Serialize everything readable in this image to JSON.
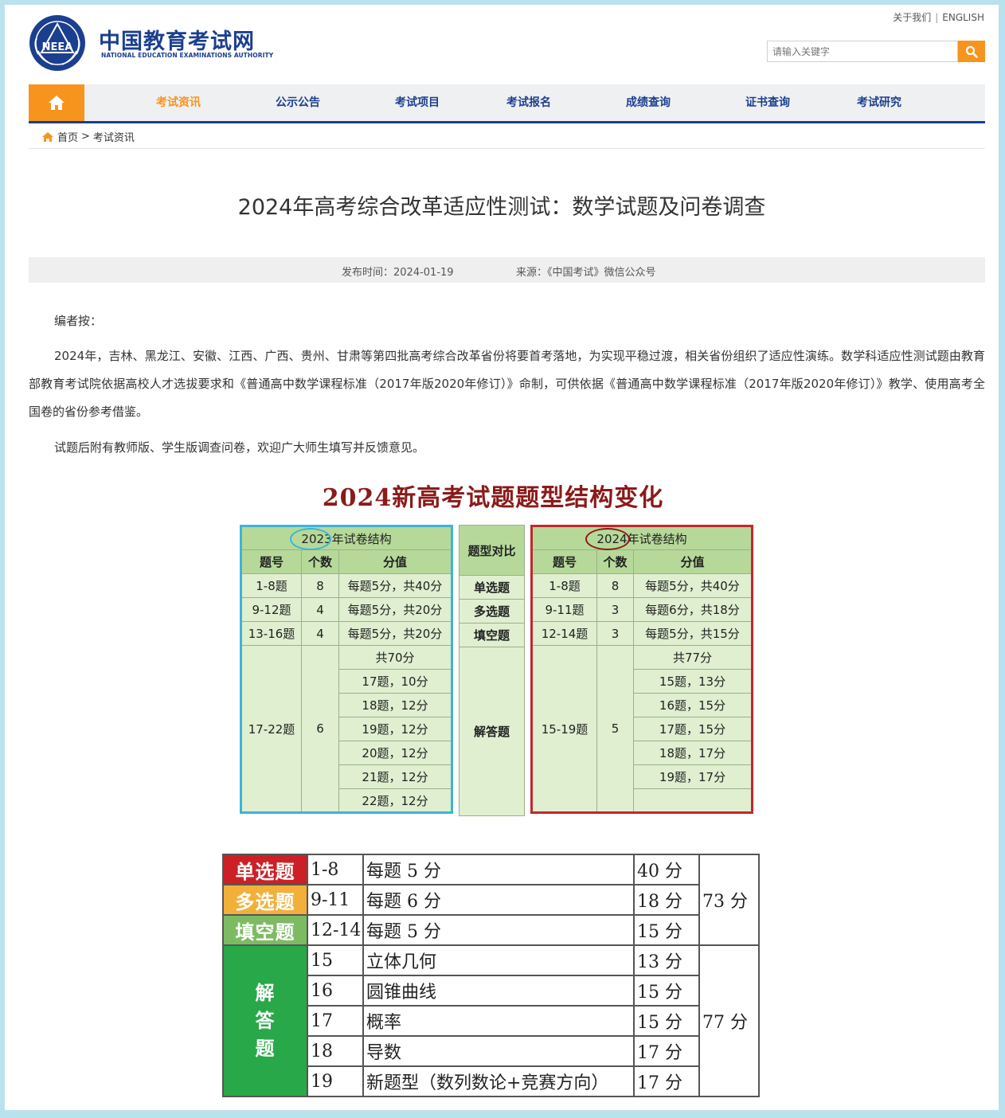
{
  "header": {
    "site_title": "中国教育考试网",
    "site_subtitle": "NATIONAL EDUCATION EXAMINATIONS AUTHORITY",
    "logo_text": "NEEA",
    "top_links": {
      "about": "关于我们",
      "separator": "|",
      "english": "ENGLISH"
    },
    "search": {
      "placeholder": "请输入关键字"
    }
  },
  "nav": {
    "items": [
      {
        "label": "考试资讯",
        "active": true
      },
      {
        "label": "公示公告"
      },
      {
        "label": "考试项目"
      },
      {
        "label": "考试报名"
      },
      {
        "label": "成绩查询"
      },
      {
        "label": "证书查询"
      },
      {
        "label": "考试研究"
      }
    ]
  },
  "breadcrumb": {
    "home": "首页",
    "separator": ">",
    "current": "考试资讯"
  },
  "article": {
    "title": "2024年高考综合改革适应性测试：数学试题及问卷调查",
    "publish_time": "发布时间：2024-01-19",
    "source": "来源：《中国考试》微信公众号",
    "editor_note": "编者按：",
    "body": "2024年，吉林、黑龙江、安徽、江西、广西、贵州、甘肃等第四批高考综合改革省份将要首考落地，为实现平稳过渡，相关省份组织了适应性演练。数学科适应性测试题由教育部教育考试院依据高校人才选拔要求和《普通高中数学课程标准（2017年版2020年修订）》命制，可供依据《普通高中数学课程标准（2017年版2020年修订）》教学、使用高考全国卷的省份参考借鉴。",
    "note": "试题后附有教师版、学生版调查问卷，欢迎广大师生填写并反馈意见。"
  },
  "infographic": {
    "title": "2024新高考试题题型结构变化",
    "t2023": {
      "caption": "2023年试卷结构",
      "headers": [
        "题号",
        "个数",
        "分值"
      ],
      "rows": [
        {
          "num": "1-8题",
          "count": "8",
          "score": "每题5分，共40分"
        },
        {
          "num": "9-12题",
          "count": "4",
          "score": "每题5分，共20分"
        },
        {
          "num": "13-16题",
          "count": "4",
          "score": "每题5分，共20分"
        }
      ],
      "big": {
        "num": "17-22题",
        "count": "6",
        "scores": [
          "共70分",
          "17题，10分",
          "18题，12分",
          "19题，12分",
          "20题，12分",
          "21题，12分",
          "22题，12分"
        ]
      }
    },
    "mid": {
      "header": "题型对比",
      "types": [
        "单选题",
        "多选题",
        "填空题",
        "解答题"
      ]
    },
    "t2024": {
      "caption": "2024年试卷结构",
      "headers": [
        "题号",
        "个数",
        "分值"
      ],
      "rows": [
        {
          "num": "1-8题",
          "count": "8",
          "score": "每题5分，共40分"
        },
        {
          "num": "9-11题",
          "count": "3",
          "score": "每题6分，共18分"
        },
        {
          "num": "12-14题",
          "count": "3",
          "score": "每题5分，共15分"
        }
      ],
      "big": {
        "num": "15-19题",
        "count": "5",
        "scores": [
          "共77分",
          "15题，13分",
          "16题，15分",
          "17题，15分",
          "18题，17分",
          "19题，17分",
          ""
        ]
      }
    },
    "lower": {
      "rows": [
        {
          "cat": "单选题",
          "num": "1-8",
          "desc": "每题 5 分",
          "score": "40 分"
        },
        {
          "cat": "多选题",
          "num": "9-11",
          "desc": "每题 6 分",
          "score": "18 分"
        },
        {
          "cat": "填空题",
          "num": "12-14",
          "desc": "每题 5 分",
          "score": "15 分"
        },
        {
          "cat": "解答题",
          "num": "15",
          "desc": "立体几何",
          "score": "13 分"
        },
        {
          "num": "16",
          "desc": "圆锥曲线",
          "score": "15 分"
        },
        {
          "num": "17",
          "desc": "概率",
          "score": "15 分"
        },
        {
          "num": "18",
          "desc": "导数",
          "score": "17 分"
        },
        {
          "num": "19",
          "desc": "新题型（数列数论+竞赛方向）",
          "score": "17 分"
        }
      ],
      "total_top": "73 分",
      "total_bottom": "77 分",
      "cat4_lines": [
        "解",
        "答",
        "题"
      ]
    }
  },
  "colors": {
    "brand_blue": "#1b3f8f",
    "accent_orange": "#f7941d",
    "cyan_border": "#3db4d8",
    "red_border": "#c0282d"
  }
}
